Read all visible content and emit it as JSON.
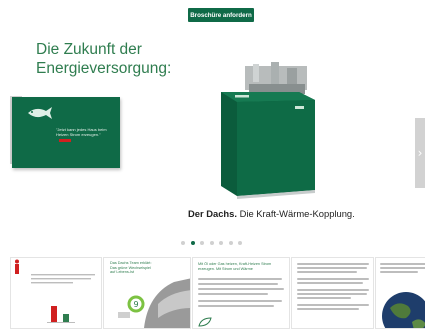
{
  "brochure_button": "Broschüre anfordern",
  "hero": {
    "headline_line1": "Die Zukunft der",
    "headline_line2": "Energieversorgung:",
    "caption_bold": "Der Dachs.",
    "caption_rest": " Die Kraft-Wärme-Kopplung.",
    "teaser_text": "\"Jetzt kann jedes Haus beim Heizen Strom erzeugen.\"",
    "prev_label": "‹",
    "next_label": "›"
  },
  "carousel": {
    "dot_count": 7,
    "active_index": 1
  },
  "thumbnails": {
    "t2_title": "Das Dachs Team erklärt: Das grüne Wechselspiel auf Lebens-Ist",
    "t3_title": "Mit Öl oder Gas heizen, Kraft-Heizen Strom erzeugen. Mit Strom und Wärme",
    "accent_color": "#0f6a47",
    "red_color": "#d02020"
  }
}
